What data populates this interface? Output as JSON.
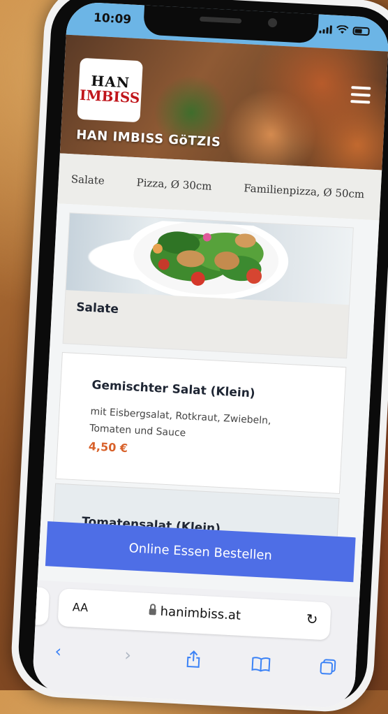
{
  "status_bar": {
    "time": "10:09"
  },
  "header": {
    "logo_line1": "HAN",
    "logo_line2": "IMBISS",
    "restaurant_name": "HAN IMBISS GöTZIS"
  },
  "category_nav": {
    "items": [
      "Salate",
      "Pizza, Ø 30cm",
      "Familienpizza, Ø 50cm"
    ]
  },
  "section": {
    "title": "Salate"
  },
  "menu_items": [
    {
      "name": "Gemischter Salat (Klein)",
      "description": "mit Eisbergsalat, Rotkraut, Zwiebeln, Tomaten und Sauce",
      "price": "4,50 €"
    },
    {
      "name": "Tomatensalat (Klein)"
    }
  ],
  "order_button": {
    "label": "Online Essen Bestellen"
  },
  "browser": {
    "text_size_label": "AA",
    "url": "hanimbiss.at"
  },
  "colors": {
    "accent_blue": "#4e6ee6",
    "price_orange": "#d8612a",
    "status_bar_blue": "#6cb5e6"
  }
}
